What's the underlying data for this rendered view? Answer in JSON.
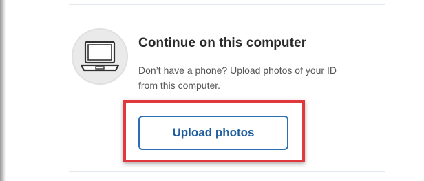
{
  "option": {
    "title": "Continue on this computer",
    "description_line1": "Don’t have a phone? Upload photos of your ID",
    "description_line2": "from this computer.",
    "icon": "laptop-icon",
    "button_label": "Upload photos"
  },
  "colors": {
    "button_border": "#2a6fb1",
    "button_text": "#1f5f9e",
    "highlight": "#e0383c",
    "title_text": "#2b2b2b",
    "description_text": "#555555"
  }
}
